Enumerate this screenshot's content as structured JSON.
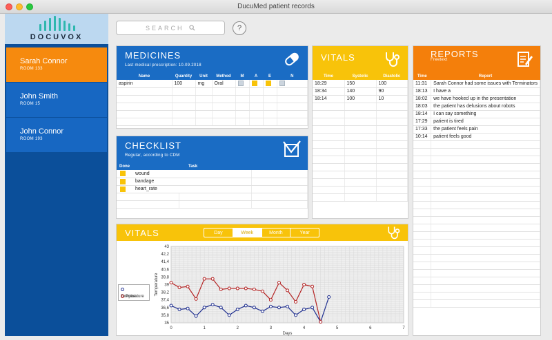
{
  "window": {
    "title": "DucuMed patient records"
  },
  "logo": {
    "text": "DOCUVOX"
  },
  "patients": [
    {
      "name": "Sarah Connor",
      "room": "ROOM 133"
    },
    {
      "name": "John Smith",
      "room": "ROOM 15"
    },
    {
      "name": "John Connor",
      "room": "ROOM 193"
    }
  ],
  "search": {
    "placeholder": "SEARCH"
  },
  "help": {
    "label": "?"
  },
  "medicines": {
    "title": "MEDICINES",
    "subtitle": "Last medical prescription: 10.09.2018",
    "columns": [
      "Name",
      "Quantity",
      "Unit",
      "Method",
      "M",
      "A",
      "E",
      "N"
    ],
    "rows": [
      {
        "name": "aspirin",
        "quantity": "100",
        "unit": "mg",
        "method": "Oral",
        "m": false,
        "a": true,
        "e": true,
        "n": false
      }
    ]
  },
  "checklist": {
    "title": "CHECKLIST",
    "subtitle": "Regular, according to CDM",
    "columns": [
      "Done",
      "Task"
    ],
    "rows": [
      {
        "done": true,
        "task": "wound"
      },
      {
        "done": true,
        "task": "bandage"
      },
      {
        "done": true,
        "task": "heart_rate"
      }
    ]
  },
  "vitals_table": {
    "title": "VITALS",
    "columns": [
      "Time",
      "Systolic",
      "Diastolic"
    ],
    "rows": [
      {
        "time": "18:29",
        "systolic": "150",
        "diastolic": "100"
      },
      {
        "time": "18:34",
        "systolic": "140",
        "diastolic": "90"
      },
      {
        "time": "18:14",
        "systolic": "100",
        "diastolic": "10"
      }
    ]
  },
  "reports": {
    "title": "REPORTS",
    "subtitle": "Freetext",
    "columns": [
      "Time",
      "Report"
    ],
    "rows": [
      {
        "time": "11:31",
        "report": "Sarah Connor had some issues with Terminators"
      },
      {
        "time": "18:13",
        "report": "I have a"
      },
      {
        "time": "18:02",
        "report": "we have hooked up in the presentation"
      },
      {
        "time": "18:03",
        "report": "the patient has delusions about robots"
      },
      {
        "time": "18:14",
        "report": "I can say something"
      },
      {
        "time": "17:29",
        "report": "patient is tired"
      },
      {
        "time": "17:33",
        "report": "the patient feels pain"
      },
      {
        "time": "10:14",
        "report": "patient feels good"
      }
    ]
  },
  "vitals_chart": {
    "title": "VITALS",
    "tabs": [
      "Day",
      "Week",
      "Month",
      "Year"
    ],
    "active_tab": "Week"
  },
  "colors": {
    "blue": "#1a6cc4",
    "yellow": "#f8c30a",
    "orange": "#f47f0b",
    "temperature": "#1f2f8f",
    "pulse": "#b32222"
  },
  "icons": {
    "medicines": "pill-icon",
    "checklist": "checkbox-icon",
    "vitals": "stethoscope-icon",
    "reports": "notepad-icon",
    "search": "magnifier-icon"
  },
  "chart_data": {
    "type": "line",
    "title": "",
    "xlabel": "Days",
    "ylabel": "Temperature",
    "xlim": [
      0,
      7
    ],
    "ylim": [
      35,
      43
    ],
    "x_ticks": [
      0,
      1,
      2,
      3,
      4,
      5,
      6,
      7
    ],
    "y_ticks": [
      "35",
      "35,8",
      "36,6",
      "37,4",
      "38,2",
      "39",
      "39,8",
      "40,6",
      "41,4",
      "42,2",
      "43"
    ],
    "grid": true,
    "legend_position": "left",
    "series": [
      {
        "name": "Temperature",
        "color": "#1f2f8f",
        "x": [
          0,
          0.25,
          0.5,
          0.75,
          1.0,
          1.25,
          1.5,
          1.75,
          2.0,
          2.25,
          2.5,
          2.75,
          3.0,
          3.25,
          3.5,
          3.75,
          4.0,
          4.25,
          4.5,
          4.75
        ],
        "y": [
          36.8,
          36.4,
          36.5,
          35.7,
          36.6,
          36.9,
          36.6,
          35.8,
          36.4,
          36.8,
          36.6,
          36.2,
          36.7,
          36.6,
          36.7,
          35.8,
          36.4,
          36.6,
          35.1,
          37.7
        ]
      },
      {
        "name": "Pulse",
        "color": "#b32222",
        "x": [
          0,
          0.25,
          0.5,
          0.75,
          1.0,
          1.25,
          1.5,
          1.75,
          2.0,
          2.25,
          2.5,
          2.75,
          3.0,
          3.25,
          3.5,
          3.75,
          4.0,
          4.25,
          4.5
        ],
        "y": [
          39.2,
          38.7,
          38.8,
          37.5,
          39.6,
          39.6,
          38.5,
          38.6,
          38.6,
          38.6,
          38.5,
          38.3,
          37.4,
          39.2,
          38.4,
          37.2,
          39.0,
          38.8,
          35.1
        ]
      }
    ]
  }
}
